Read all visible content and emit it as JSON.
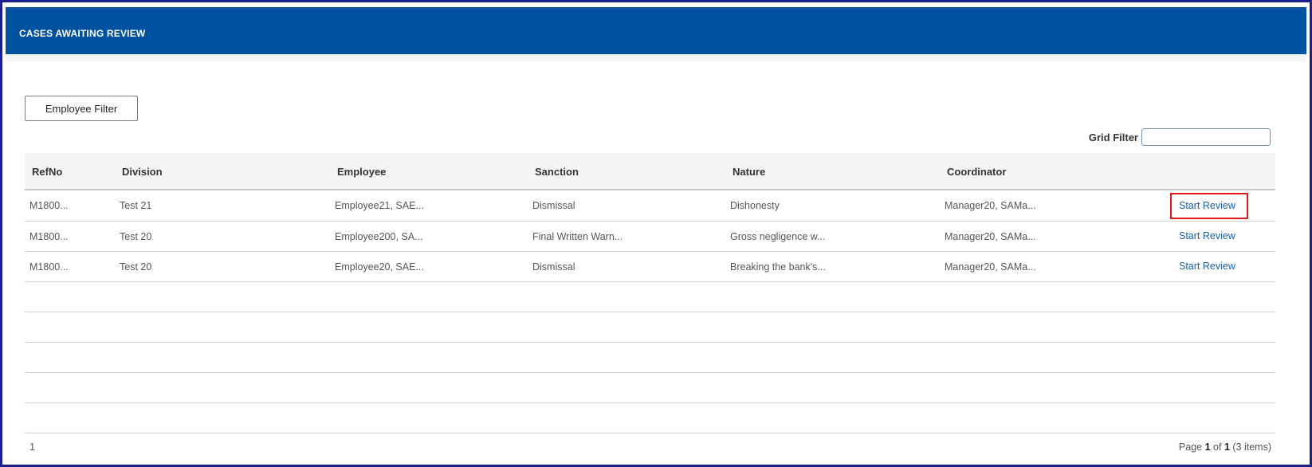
{
  "header": {
    "title": "CASES AWAITING REVIEW",
    "color": "#0052a0"
  },
  "toolbar": {
    "employee_filter_label": "Employee Filter",
    "grid_filter_label": "Grid Filter",
    "grid_filter_value": ""
  },
  "grid": {
    "columns": [
      "RefNo",
      "Division",
      "Employee",
      "Sanction",
      "Nature",
      "Coordinator"
    ],
    "rows": [
      {
        "refno": "M1800...",
        "division": "Test 21",
        "employee": "Employee21, SAE...",
        "sanction": "Dismissal",
        "nature": "Dishonesty",
        "coordinator": "Manager20, SAMa...",
        "action": "Start Review"
      },
      {
        "refno": "M1800...",
        "division": "Test 20",
        "employee": "Employee200, SA...",
        "sanction": "Final Written Warn...",
        "nature": "Gross negligence w...",
        "coordinator": "Manager20, SAMa...",
        "action": "Start Review"
      },
      {
        "refno": "M1800...",
        "division": "Test 20",
        "employee": "Employee20, SAE...",
        "sanction": "Dismissal",
        "nature": "Breaking the bank's...",
        "coordinator": "Manager20, SAMa...",
        "action": "Start Review"
      }
    ],
    "empty_rows": 5,
    "action_color": "#1a5fa8",
    "highlight_color": "#e01818"
  },
  "pager": {
    "current_page_link": "1",
    "page_word": "Page",
    "page": "1",
    "of_word": "of",
    "total_pages": "1",
    "items_text": "(3 items)"
  }
}
